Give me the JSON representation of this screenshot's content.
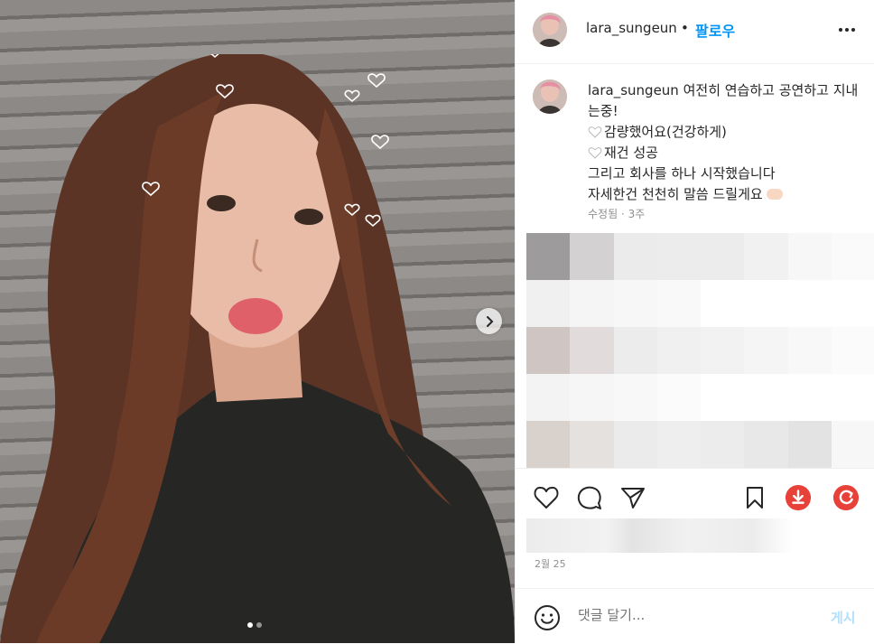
{
  "post": {
    "username": "lara_sungeun",
    "separator": "•",
    "follow_label": "팔로우",
    "more_icon": "more-horizontal-icon",
    "image_alt_carousel": {
      "current": 1,
      "total": 2
    }
  },
  "caption": {
    "username": "lara_sungeun",
    "lines": [
      "여전히 연습하고 공연하고 지내는중!",
      "감량했어요(건강하게)",
      "재건 성공",
      "그리고 회사를 하나 시작했습니다",
      "자세한건 천천히 말씀 드릴게요"
    ],
    "meta": "수정됨 · 3주"
  },
  "actions": {
    "like_icon": "heart-icon",
    "comment_icon": "comment-icon",
    "share_icon": "send-icon",
    "save_icon": "bookmark-icon",
    "download_icon": "download-icon",
    "refresh_icon": "refresh-icon"
  },
  "date": "2월 25",
  "comment": {
    "placeholder": "댓글 달기...",
    "post_label": "게시",
    "emoji_icon": "smiley-icon"
  },
  "colors": {
    "accent": "#0095f6",
    "post_disabled": "#b2dffc",
    "download_red": "#e8413a",
    "refresh_red": "#e8413a"
  }
}
